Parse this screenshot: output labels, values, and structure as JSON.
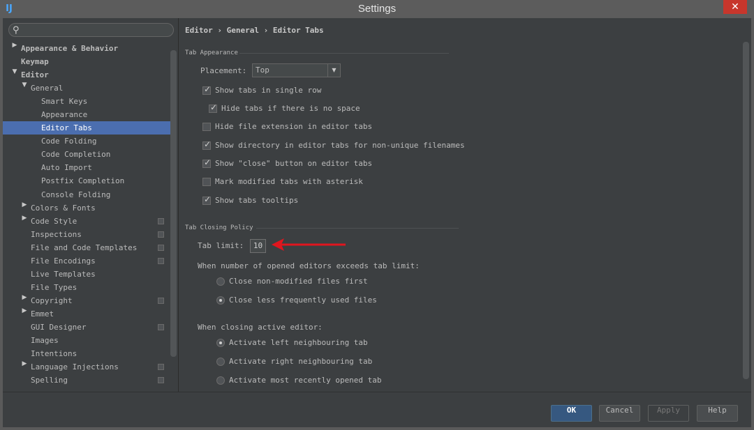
{
  "window": {
    "title": "Settings",
    "app_icon": "intellij-icon",
    "close_symbol": "✕"
  },
  "search": {
    "placeholder": "",
    "value": ""
  },
  "tree": [
    {
      "label": "Appearance & Behavior",
      "level": 0,
      "arrow": "▶",
      "bold": true
    },
    {
      "label": "Keymap",
      "level": 0,
      "arrow": "",
      "bold": true
    },
    {
      "label": "Editor",
      "level": 0,
      "arrow": "▼",
      "bold": true
    },
    {
      "label": "General",
      "level": 1,
      "arrow": "▼"
    },
    {
      "label": "Smart Keys",
      "level": 2
    },
    {
      "label": "Appearance",
      "level": 2
    },
    {
      "label": "Editor Tabs",
      "level": 2,
      "selected": true
    },
    {
      "label": "Code Folding",
      "level": 2
    },
    {
      "label": "Code Completion",
      "level": 2
    },
    {
      "label": "Auto Import",
      "level": 2
    },
    {
      "label": "Postfix Completion",
      "level": 2
    },
    {
      "label": "Console Folding",
      "level": 2
    },
    {
      "label": "Colors & Fonts",
      "level": 1,
      "arrow": "▶"
    },
    {
      "label": "Code Style",
      "level": 1,
      "arrow": "▶",
      "project_icon": true
    },
    {
      "label": "Inspections",
      "level": 1,
      "project_icon": true
    },
    {
      "label": "File and Code Templates",
      "level": 1,
      "project_icon": true
    },
    {
      "label": "File Encodings",
      "level": 1,
      "project_icon": true
    },
    {
      "label": "Live Templates",
      "level": 1
    },
    {
      "label": "File Types",
      "level": 1
    },
    {
      "label": "Copyright",
      "level": 1,
      "arrow": "▶",
      "project_icon": true
    },
    {
      "label": "Emmet",
      "level": 1,
      "arrow": "▶"
    },
    {
      "label": "GUI Designer",
      "level": 1,
      "project_icon": true
    },
    {
      "label": "Images",
      "level": 1
    },
    {
      "label": "Intentions",
      "level": 1
    },
    {
      "label": "Language Injections",
      "level": 1,
      "arrow": "▶",
      "project_icon": true
    },
    {
      "label": "Spelling",
      "level": 1,
      "project_icon": true
    }
  ],
  "breadcrumb": "Editor › General › Editor Tabs",
  "tab_appearance": {
    "title": "Tab Appearance",
    "placement_label": "Placement:",
    "placement_value": "Top",
    "options": [
      {
        "label": "Show tabs in single row",
        "checked": true
      },
      {
        "label": "Hide tabs if there is no space",
        "checked": true
      },
      {
        "label": "Hide file extension in editor tabs",
        "checked": false
      },
      {
        "label": "Show directory in editor tabs for non-unique filenames",
        "checked": true
      },
      {
        "label": "Show \"close\" button on editor tabs",
        "checked": true
      },
      {
        "label": "Mark modified tabs with asterisk",
        "checked": false
      },
      {
        "label": "Show tabs tooltips",
        "checked": true
      }
    ]
  },
  "tab_closing": {
    "title": "Tab Closing Policy",
    "tab_limit_label": "Tab limit:",
    "tab_limit_value": "10",
    "exceeds_label": "When number of opened editors exceeds tab limit:",
    "exceeds_options": [
      {
        "label": "Close non-modified files first",
        "selected": false
      },
      {
        "label": "Close less frequently used files",
        "selected": true
      }
    ],
    "closing_label": "When closing active editor:",
    "closing_options": [
      {
        "label": "Activate left neighbouring tab",
        "selected": true
      },
      {
        "label": "Activate right neighbouring tab",
        "selected": false
      },
      {
        "label": "Activate most recently opened tab",
        "selected": false
      }
    ]
  },
  "buttons": {
    "ok": "OK",
    "cancel": "Cancel",
    "apply": "Apply",
    "help": "Help"
  },
  "colors": {
    "selection": "#4b6eaf",
    "annotation_arrow": "#e0161e",
    "primary_button": "#365880"
  }
}
